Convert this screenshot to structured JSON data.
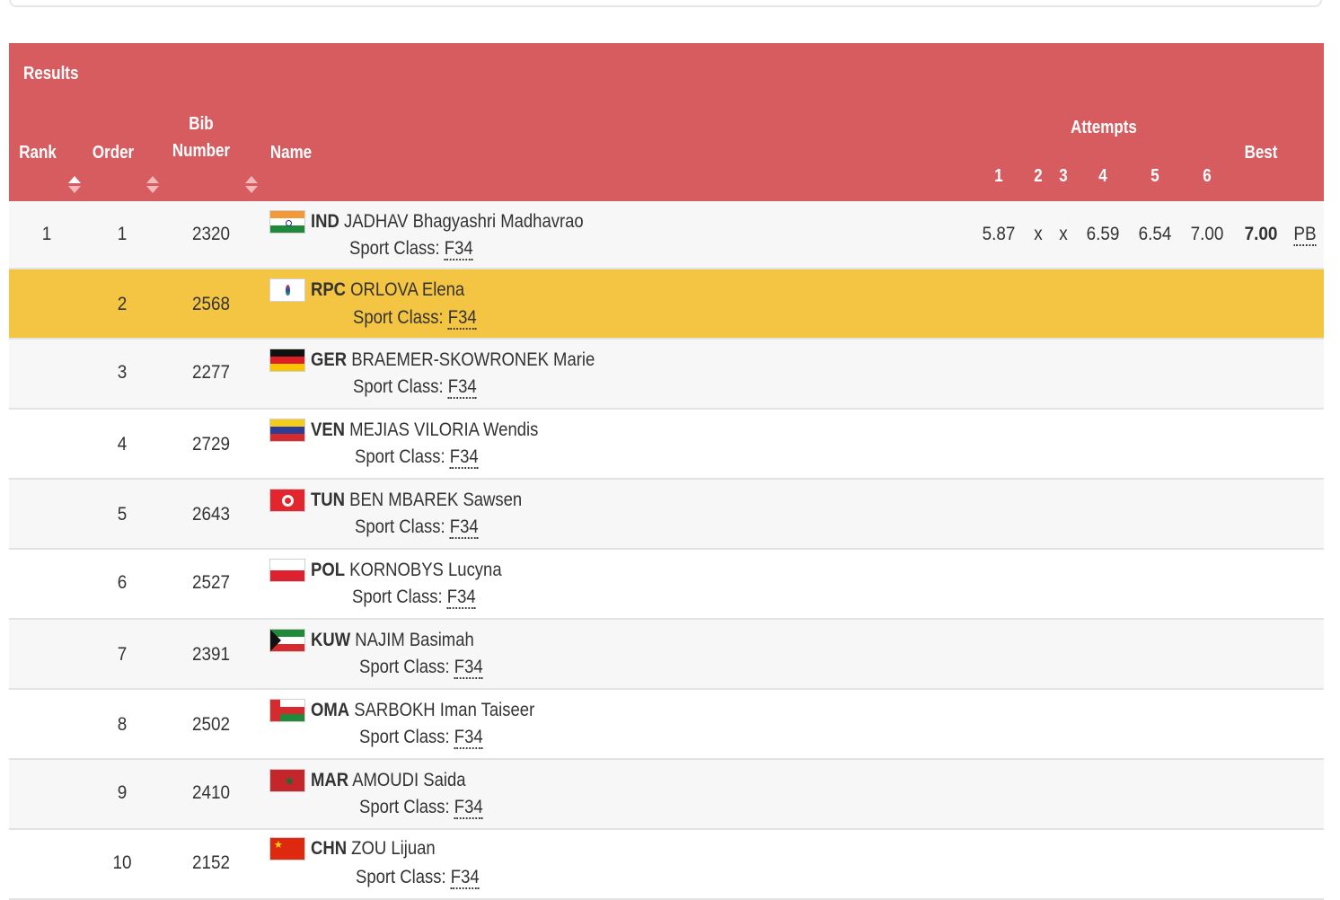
{
  "header": {
    "title": "Results",
    "col_rank": "Rank",
    "col_order": "Order",
    "col_bib_line1": "Bib",
    "col_bib_line2": "Number",
    "col_name": "Name",
    "col_attempts": "Attempts",
    "attempt_numbers": [
      "1",
      "2",
      "3",
      "4",
      "5",
      "6"
    ],
    "col_best": "Best"
  },
  "colors": {
    "header_bg": "#d65c60",
    "highlight_row": "#f4c443",
    "stripe": "#f7f7f7"
  },
  "sport_class_label": "Sport Class:",
  "rows": [
    {
      "rank": "1",
      "order": "1",
      "bib": "2320",
      "noc": "IND",
      "name": "JADHAV Bhagyashri Madhavrao",
      "sport_class": "F34",
      "flag": "india-flag",
      "attempts": [
        "5.87",
        "x",
        "x",
        "6.59",
        "6.54",
        "7.00"
      ],
      "best": "7.00",
      "record": "PB"
    },
    {
      "rank": "",
      "order": "2",
      "bib": "2568",
      "noc": "RPC",
      "name": "ORLOVA Elena",
      "sport_class": "F34",
      "flag": "rpc-flag"
    },
    {
      "rank": "",
      "order": "3",
      "bib": "2277",
      "noc": "GER",
      "name": "BRAEMER-SKOWRONEK Marie",
      "sport_class": "F34",
      "flag": "germany-flag"
    },
    {
      "rank": "",
      "order": "4",
      "bib": "2729",
      "noc": "VEN",
      "name": "MEJIAS VILORIA Wendis",
      "sport_class": "F34",
      "flag": "venezuela-flag"
    },
    {
      "rank": "",
      "order": "5",
      "bib": "2643",
      "noc": "TUN",
      "name": "BEN MBAREK Sawsen",
      "sport_class": "F34",
      "flag": "tunisia-flag"
    },
    {
      "rank": "",
      "order": "6",
      "bib": "2527",
      "noc": "POL",
      "name": "KORNOBYS Lucyna",
      "sport_class": "F34",
      "flag": "poland-flag"
    },
    {
      "rank": "",
      "order": "7",
      "bib": "2391",
      "noc": "KUW",
      "name": "NAJIM Basimah",
      "sport_class": "F34",
      "flag": "kuwait-flag"
    },
    {
      "rank": "",
      "order": "8",
      "bib": "2502",
      "noc": "OMA",
      "name": "SARBOKH Iman Taiseer",
      "sport_class": "F34",
      "flag": "oman-flag"
    },
    {
      "rank": "",
      "order": "9",
      "bib": "2410",
      "noc": "MAR",
      "name": "AMOUDI Saida",
      "sport_class": "F34",
      "flag": "morocco-flag"
    },
    {
      "rank": "",
      "order": "10",
      "bib": "2152",
      "noc": "CHN",
      "name": "ZOU Lijuan",
      "sport_class": "F34",
      "flag": "china-flag"
    }
  ]
}
